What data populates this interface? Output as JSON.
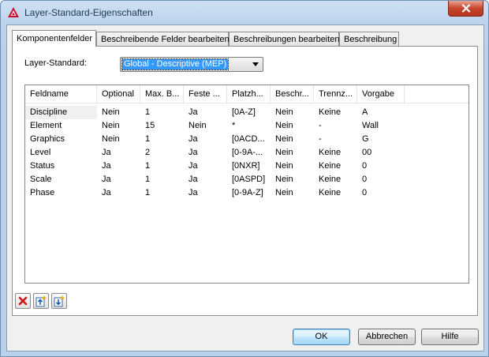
{
  "window": {
    "title": "Layer-Standard-Eigenschaften"
  },
  "tabs": [
    {
      "label": "Komponentenfelder",
      "active": true
    },
    {
      "label": "Beschreibende Felder bearbeiten",
      "active": false
    },
    {
      "label": "Beschreibungen bearbeiten",
      "active": false
    },
    {
      "label": "Beschreibung",
      "active": false
    }
  ],
  "layer_standard": {
    "label": "Layer-Standard:",
    "value": "Global - Descriptive (MEP)"
  },
  "table": {
    "columns": [
      "Feldname",
      "Optional",
      "Max. B...",
      "Feste ...",
      "Platzh...",
      "Beschr...",
      "Trennz...",
      "Vorgabe"
    ],
    "rows": [
      [
        "Discipline",
        "Nein",
        "1",
        "Ja",
        "[0A-Z]",
        "Nein",
        "Keine",
        "A"
      ],
      [
        "Element",
        "Nein",
        "15",
        "Nein",
        "*",
        "Nein",
        "-",
        "Wall"
      ],
      [
        "Graphics",
        "Nein",
        "1",
        "Ja",
        "[0ACD...",
        "Nein",
        "-",
        "G"
      ],
      [
        "Level",
        "Ja",
        "2",
        "Ja",
        "[0-9A-...",
        "Nein",
        "Keine",
        "00"
      ],
      [
        "Status",
        "Ja",
        "1",
        "Ja",
        "[0NXR]",
        "Nein",
        "Keine",
        "0"
      ],
      [
        "Scale",
        "Ja",
        "1",
        "Ja",
        "[0ASPD]",
        "Nein",
        "Keine",
        "0"
      ],
      [
        "Phase",
        "Ja",
        "1",
        "Ja",
        "[0-9A-Z]",
        "Nein",
        "Keine",
        "0"
      ]
    ]
  },
  "icon_buttons": [
    {
      "icon": "delete-icon"
    },
    {
      "icon": "move-up-icon"
    },
    {
      "icon": "move-down-icon"
    }
  ],
  "buttons": {
    "ok": "OK",
    "cancel": "Abbrechen",
    "help": "Hilfe"
  },
  "colors": {
    "selection": "#3399ff",
    "titlebar": "#b9d1ea",
    "close": "#c7462d"
  }
}
